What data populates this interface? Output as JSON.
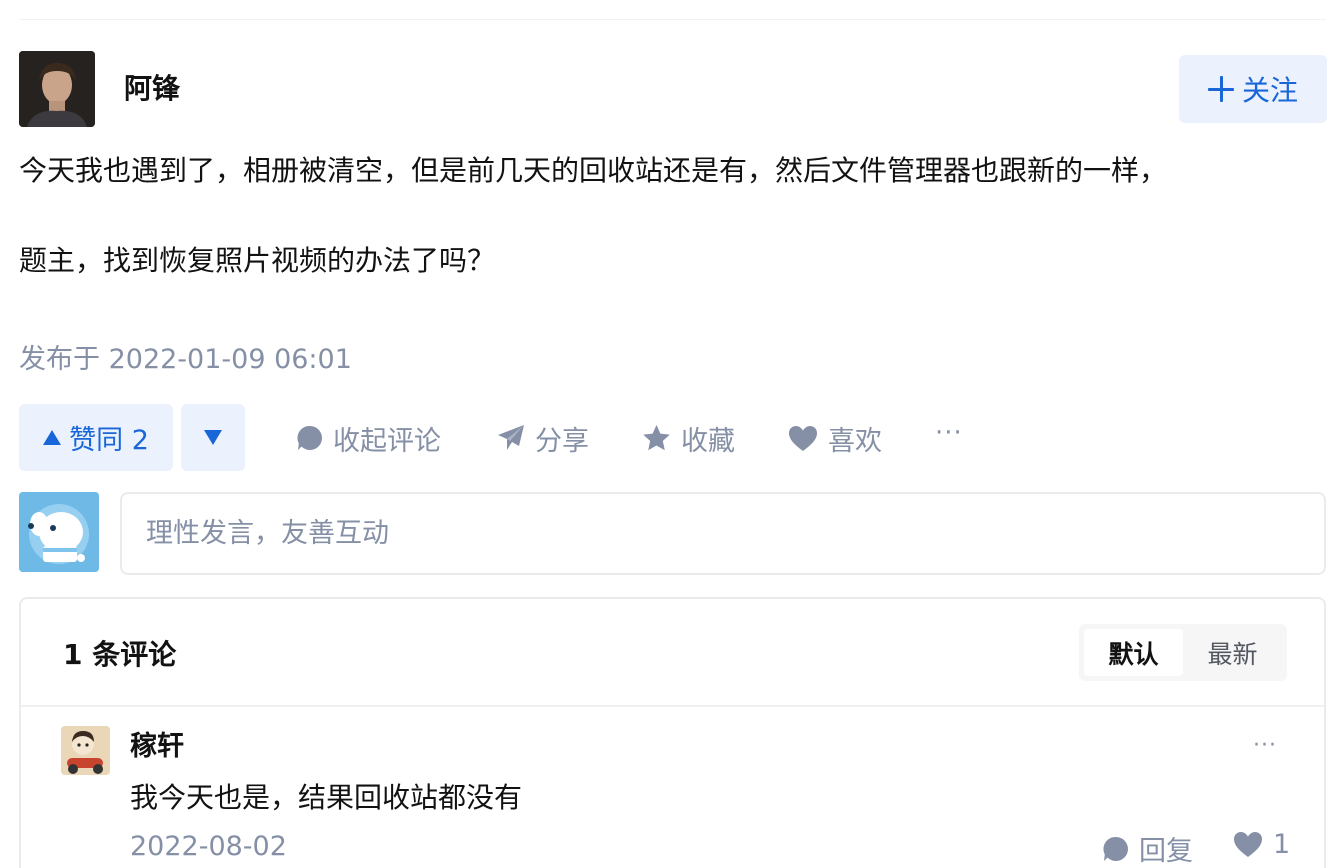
{
  "answer": {
    "author": {
      "name": "阿锋",
      "follow_label": "关注"
    },
    "content": [
      "今天我也遇到了，相册被清空，但是前几天的回收站还是有，然后文件管理器也跟新的一样，",
      "题主，找到恢复照片视频的办法了吗？"
    ],
    "publish_time": "发布于 2022-01-09 06:01",
    "actions": {
      "vote_up_label": "赞同 2",
      "collapse_comments_label": "收起评论",
      "share_label": "分享",
      "collect_label": "收藏",
      "like_label": "喜欢",
      "more_label": "···"
    },
    "comment_box": {
      "placeholder": "理性发言，友善互动"
    },
    "comments": {
      "count_label": "1 条评论",
      "sort": {
        "default_label": "默认",
        "latest_label": "最新"
      },
      "items": [
        {
          "author": "稼轩",
          "text": "我今天也是，结果回收站都没有",
          "date": "2022-08-02",
          "reply_label": "回复",
          "like_count": "1",
          "more_label": "···"
        }
      ]
    }
  },
  "colors": {
    "accent": "#1966d9",
    "accent_bg": "#ebf2fd",
    "muted_text": "#8590a6",
    "primary_text": "#121212"
  }
}
